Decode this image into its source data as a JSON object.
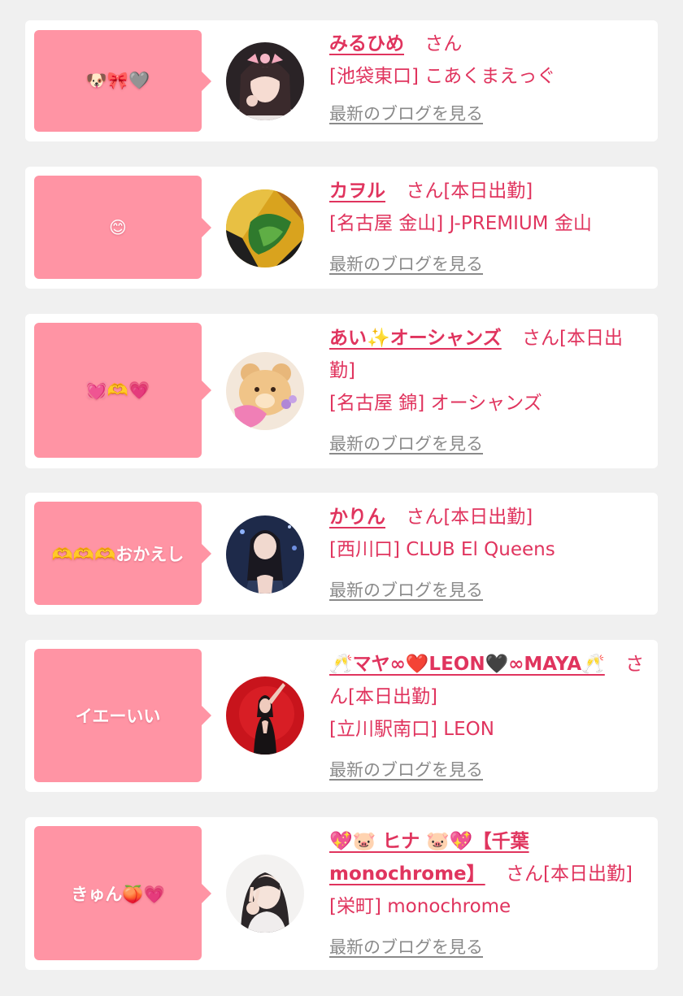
{
  "colors": {
    "background": "#f0f0f0",
    "card": "#ffffff",
    "bubble": "#ff94a4",
    "accent_text": "#e0345e",
    "link_gray": "#8a8a8a"
  },
  "entries": [
    {
      "message": "🐶🎀🩶",
      "name": "みるひめ",
      "honorific": "さん",
      "status": "",
      "location": "[池袋東口]",
      "shop": "こあくまえっぐ",
      "blog_link": "最新のブログを見る",
      "avatar_icon": "girl-portrait-photo"
    },
    {
      "message": "😊",
      "name": "カヲル",
      "honorific": "さん",
      "status": "[本日出勤]",
      "location": "[名古屋 金山]",
      "shop": "J-PREMIUM 金山",
      "blog_link": "最新のブログを見る",
      "avatar_icon": "art-avatar-photo"
    },
    {
      "message": "💓🫶💗",
      "name": "あい✨オーシャンズ",
      "honorific": "さん",
      "status": "[本日出勤]",
      "location": "[名古屋 錦]",
      "shop": "オーシャンズ",
      "blog_link": "最新のブログを見る",
      "avatar_icon": "bear-plush-photo"
    },
    {
      "message": "🫶🫶🫶おかえし",
      "name": "かりん",
      "honorific": "さん",
      "status": "[本日出勤]",
      "location": "[西川口]",
      "shop": "CLUB El Queens",
      "blog_link": "最新のブログを見る",
      "avatar_icon": "girl-night-photo"
    },
    {
      "message": "イエーいい",
      "name": "🥂マヤ∞❤️LEON🖤∞MAYA🥂",
      "honorific": "さん",
      "status": "[本日出勤]",
      "location": "[立川駅南口]",
      "shop": "LEON",
      "blog_link": "最新のブログを見る",
      "avatar_icon": "girl-red-background-photo"
    },
    {
      "message": "きゅん🍑💗",
      "name": "💖🐷 ヒナ 🐷💖【千葉monochrome】",
      "honorific": "さん",
      "status": "[本日出勤]",
      "location": "[栄町]",
      "shop": "monochrome",
      "blog_link": "最新のブログを見る",
      "avatar_icon": "girl-peace-sign-photo"
    }
  ]
}
